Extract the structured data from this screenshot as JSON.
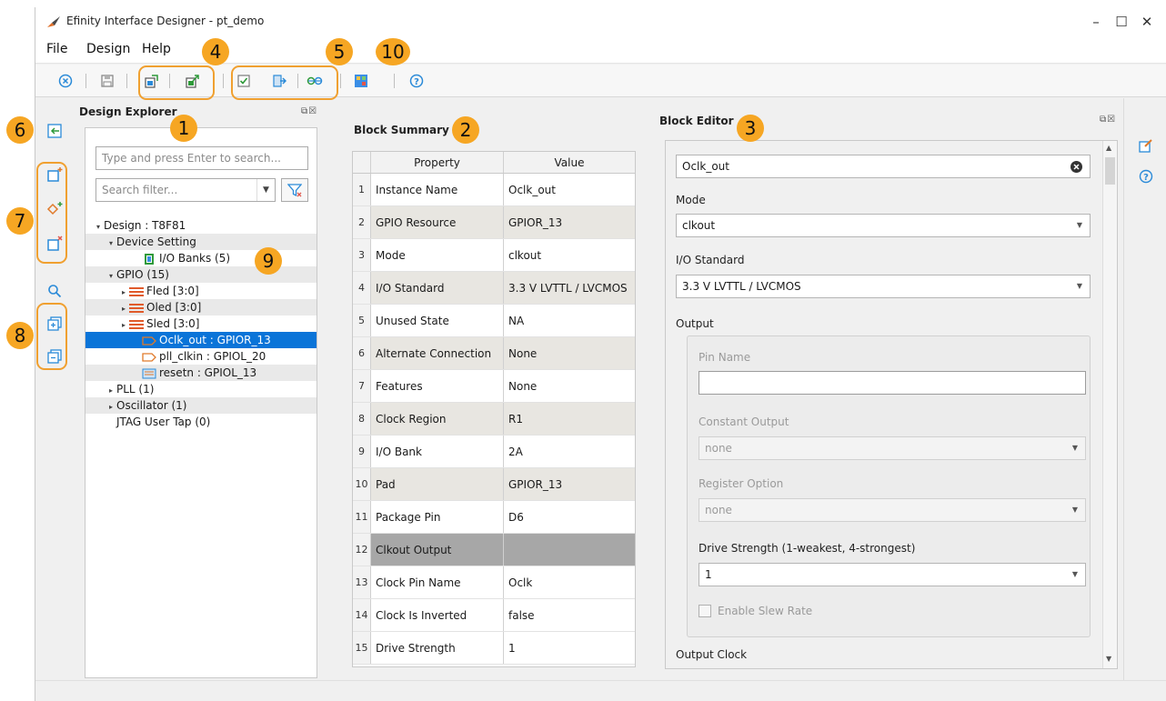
{
  "window": {
    "title": "Efinity Interface Designer - pt_demo",
    "minimize_glyph": "–",
    "maximize_glyph": "☐",
    "close_glyph": "✕"
  },
  "menu": [
    "File",
    "Design",
    "Help"
  ],
  "toolbar": {
    "icons": [
      "close-circle-icon",
      "save-icon",
      "import-icon",
      "export-icon",
      "check-icon",
      "generate-icon",
      "link-icon",
      "report-icon",
      "help-icon"
    ]
  },
  "callouts": [
    "1",
    "2",
    "3",
    "4",
    "5",
    "6",
    "7",
    "8",
    "9",
    "10"
  ],
  "explorer": {
    "title": "Design Explorer",
    "search_placeholder": "Type and press Enter to search...",
    "filter_placeholder": "Search filter...",
    "tree": [
      {
        "label": "Design : T8F81",
        "level": 0,
        "twisty": "▾",
        "icon": ""
      },
      {
        "label": "Device Setting",
        "level": 1,
        "twisty": "▾",
        "icon": ""
      },
      {
        "label": "I/O Banks (5)",
        "level": 3,
        "twisty": "",
        "icon": "io-banks"
      },
      {
        "label": "GPIO (15)",
        "level": 1,
        "twisty": "▾",
        "icon": ""
      },
      {
        "label": "Fled [3:0]",
        "level": 2,
        "twisty": "▸",
        "icon": "bus"
      },
      {
        "label": "Oled [3:0]",
        "level": 2,
        "twisty": "▸",
        "icon": "bus"
      },
      {
        "label": "Sled [3:0]",
        "level": 2,
        "twisty": "▸",
        "icon": "bus"
      },
      {
        "label": "Oclk_out : GPIOR_13",
        "level": 3,
        "twisty": "",
        "icon": "out-pin"
      },
      {
        "label": "pll_clkin : GPIOL_20",
        "level": 3,
        "twisty": "",
        "icon": "in-pin"
      },
      {
        "label": "resetn : GPIOL_13",
        "level": 3,
        "twisty": "",
        "icon": "reg-pin"
      },
      {
        "label": "PLL (1)",
        "level": 1,
        "twisty": "▸",
        "icon": ""
      },
      {
        "label": "Oscillator (1)",
        "level": 1,
        "twisty": "▸",
        "icon": ""
      },
      {
        "label": "JTAG User Tap (0)",
        "level": 1,
        "twisty": "",
        "icon": ""
      }
    ]
  },
  "summary": {
    "title": "Block Summary",
    "headers": [
      "Property",
      "Value"
    ],
    "rows": [
      [
        "1",
        "Instance Name",
        "Oclk_out"
      ],
      [
        "2",
        "GPIO Resource",
        "GPIOR_13"
      ],
      [
        "3",
        "Mode",
        "clkout"
      ],
      [
        "4",
        "I/O Standard",
        "3.3 V LVTTL / LVCMOS"
      ],
      [
        "5",
        "Unused State",
        "NA"
      ],
      [
        "6",
        "Alternate Connection",
        "None"
      ],
      [
        "7",
        "Features",
        "None"
      ],
      [
        "8",
        "Clock Region",
        "R1"
      ],
      [
        "9",
        "I/O Bank",
        "2A"
      ],
      [
        "10",
        "Pad",
        "GPIOR_13"
      ],
      [
        "11",
        "Package Pin",
        "D6"
      ],
      [
        "12",
        "Clkout Output",
        ""
      ],
      [
        "13",
        "Clock Pin Name",
        "Oclk"
      ],
      [
        "14",
        "Clock Is Inverted",
        "false"
      ],
      [
        "15",
        "Drive Strength",
        "1"
      ]
    ]
  },
  "editor": {
    "title": "Block Editor",
    "instance_name": "Oclk_out",
    "mode_label": "Mode",
    "mode_value": "clkout",
    "io_standard_label": "I/O Standard",
    "io_standard_value": "3.3 V LVTTL / LVCMOS",
    "output_label": "Output",
    "pin_name_label": "Pin Name",
    "pin_name_value": "",
    "constant_output_label": "Constant Output",
    "constant_output_value": "none",
    "register_option_label": "Register Option",
    "register_option_value": "none",
    "drive_strength_label": "Drive Strength (1-weakest, 4-strongest)",
    "drive_strength_value": "1",
    "slew_label": "Enable Slew Rate",
    "output_clock_label": "Output Clock"
  },
  "panel_controls": "⧉☒"
}
